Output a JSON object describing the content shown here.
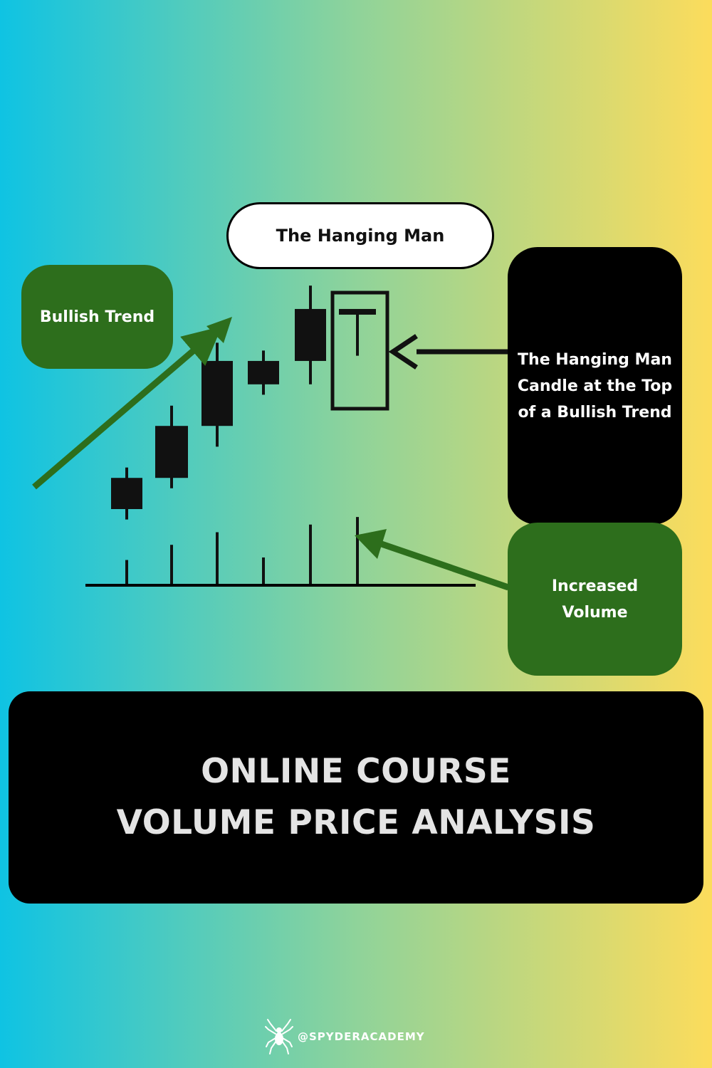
{
  "labels": {
    "title": "The Hanging Man",
    "bullish_trend": "Bullish Trend",
    "hanging_man_desc": "The Hanging Man Candle at the Top of a Bullish Trend",
    "increased_volume": "Increased Volume"
  },
  "banner": {
    "line1": "ONLINE COURSE",
    "line2": "VOLUME PRICE ANALYSIS"
  },
  "brand": {
    "handle": "@SPYDERACADEMY",
    "icon": "spider-icon"
  },
  "colors": {
    "gradient_left": "#0fc3e3",
    "gradient_mid": "#8fd39a",
    "gradient_right": "#fcdc5c",
    "green": "#2d6e1c",
    "black": "#000000"
  },
  "chart_data": {
    "type": "candlestick",
    "candles": [
      {
        "open": 1.0,
        "close": 1.6,
        "high": 1.8,
        "low": 0.8
      },
      {
        "open": 1.6,
        "close": 2.6,
        "high": 2.99,
        "low": 1.4
      },
      {
        "open": 2.6,
        "close": 3.85,
        "high": 4.2,
        "low": 2.2
      },
      {
        "open": 3.4,
        "close": 3.85,
        "high": 4.05,
        "low": 3.2
      },
      {
        "open": 3.85,
        "close": 4.85,
        "high": 5.3,
        "low": 3.4
      },
      {
        "open": 4.75,
        "close": 4.85,
        "high": 4.85,
        "low": 3.95
      }
    ],
    "volume": [
      1.0,
      1.6,
      2.1,
      1.1,
      2.4,
      2.7
    ],
    "highlighted_index": 5
  }
}
